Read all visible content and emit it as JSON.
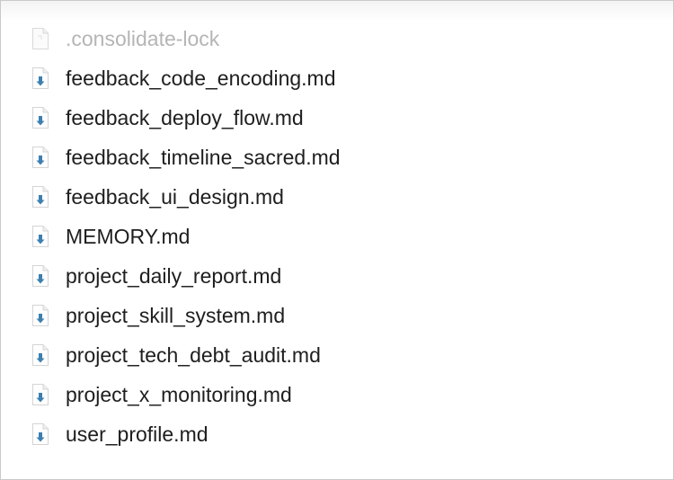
{
  "files": [
    {
      "name": ".consolidate-lock",
      "icon": "generic-document-icon",
      "dimmed": true
    },
    {
      "name": "feedback_code_encoding.md",
      "icon": "markdown-download-icon",
      "dimmed": false
    },
    {
      "name": "feedback_deploy_flow.md",
      "icon": "markdown-download-icon",
      "dimmed": false
    },
    {
      "name": "feedback_timeline_sacred.md",
      "icon": "markdown-download-icon",
      "dimmed": false
    },
    {
      "name": "feedback_ui_design.md",
      "icon": "markdown-download-icon",
      "dimmed": false
    },
    {
      "name": "MEMORY.md",
      "icon": "markdown-download-icon",
      "dimmed": false
    },
    {
      "name": "project_daily_report.md",
      "icon": "markdown-download-icon",
      "dimmed": false
    },
    {
      "name": "project_skill_system.md",
      "icon": "markdown-download-icon",
      "dimmed": false
    },
    {
      "name": "project_tech_debt_audit.md",
      "icon": "markdown-download-icon",
      "dimmed": false
    },
    {
      "name": "project_x_monitoring.md",
      "icon": "markdown-download-icon",
      "dimmed": false
    },
    {
      "name": "user_profile.md",
      "icon": "markdown-download-icon",
      "dimmed": false
    }
  ],
  "colors": {
    "text": "#1e1e1e",
    "dimmed_text": "#b5b5b5",
    "icon_arrow": "#3d7fb0",
    "window_border": "#c9c9c9"
  }
}
